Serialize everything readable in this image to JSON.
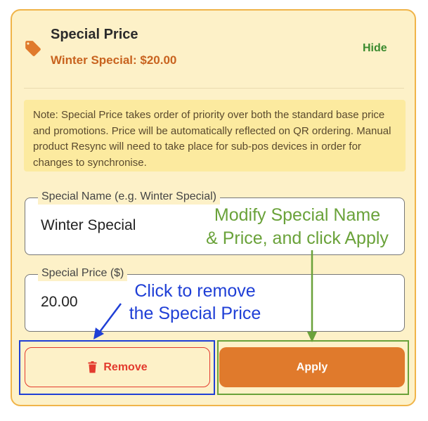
{
  "header": {
    "icon": "tag-icon",
    "title": "Special Price",
    "subtitle": "Winter Special: $20.00",
    "hide_label": "Hide"
  },
  "note": {
    "text": "Note: Special Price takes order of priority over both the standard base price and promotions. Price will be automatically reflected on QR ordering. Manual product Resync will need to take place for sub-pos devices in order for changes to synchronise."
  },
  "form": {
    "name_label": "Special Name (e.g. Winter Special)",
    "name_value": "Winter Special",
    "price_label": "Special Price ($)",
    "price_value": "20.00"
  },
  "buttons": {
    "remove_label": "Remove",
    "remove_icon": "trash-icon",
    "apply_label": "Apply"
  },
  "annotations": {
    "modify_line1": "Modify Special Name",
    "modify_line2": "& Price, and click Apply",
    "remove_line1": "Click to remove",
    "remove_line2": "the Special Price"
  },
  "colors": {
    "accent": "#e07a2c",
    "card_bg": "#fdf1c8",
    "danger": "#e33b2e",
    "success": "#3a8a2e",
    "annotation_green": "#6aa23a",
    "annotation_blue": "#1f3fd6"
  }
}
